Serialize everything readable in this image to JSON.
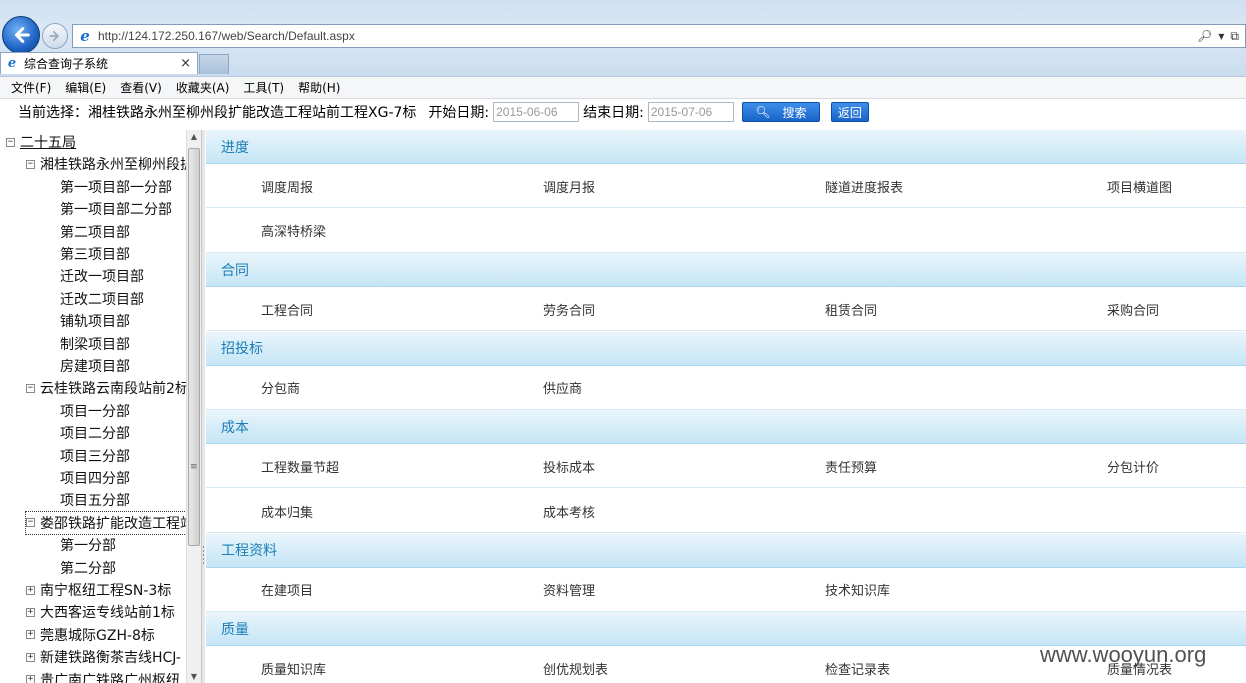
{
  "browser": {
    "url": "http://124.172.250.167/web/Search/Default.aspx",
    "tab_title": "综合查询子系统",
    "tab_close": "×"
  },
  "menu": [
    "文件(F)",
    "编辑(E)",
    "查看(V)",
    "收藏夹(A)",
    "工具(T)",
    "帮助(H)"
  ],
  "filter": {
    "current_label": "当前选择：湘桂铁路永州至柳州段扩能改造工程站前工程XG-7标",
    "start_label": "开始日期:",
    "start_value": "2015-06-06",
    "end_label": "结束日期:",
    "end_value": "2015-07-06",
    "search_label": "搜索",
    "back_label": "返回"
  },
  "tree": [
    {
      "label": "二十五局",
      "toggle": "−"
    },
    {
      "label": "湘桂铁路永州至柳州段扩",
      "toggle": "−"
    },
    {
      "label": "第一项目部一分部"
    },
    {
      "label": "第一项目部二分部"
    },
    {
      "label": "第二项目部"
    },
    {
      "label": "第三项目部"
    },
    {
      "label": "迁改一项目部"
    },
    {
      "label": "迁改二项目部"
    },
    {
      "label": "铺轨项目部"
    },
    {
      "label": "制梁项目部"
    },
    {
      "label": "房建项目部"
    },
    {
      "label": "云桂铁路云南段站前2标",
      "toggle": "−"
    },
    {
      "label": "项目一分部"
    },
    {
      "label": "项目二分部"
    },
    {
      "label": "项目三分部"
    },
    {
      "label": "项目四分部"
    },
    {
      "label": "项目五分部"
    },
    {
      "label": "娄邵铁路扩能改造工程站",
      "toggle": "−"
    },
    {
      "label": "第一分部"
    },
    {
      "label": "第二分部"
    },
    {
      "label": "南宁枢纽工程SN-3标",
      "toggle": "+"
    },
    {
      "label": "大西客运专线站前1标",
      "toggle": "+"
    },
    {
      "label": "莞惠城际GZH-8标",
      "toggle": "+"
    },
    {
      "label": "新建铁路衡茶吉线HCJ-",
      "toggle": "+"
    },
    {
      "label": "贵广南广铁路广州枢纽",
      "toggle": "+"
    }
  ],
  "sections": [
    {
      "title": "进度",
      "rows": [
        [
          "调度周报",
          "调度月报",
          "隧道进度报表",
          "项目横道图"
        ],
        [
          "高深特桥梁"
        ]
      ]
    },
    {
      "title": "合同",
      "rows": [
        [
          "工程合同",
          "劳务合同",
          "租赁合同",
          "采购合同"
        ]
      ]
    },
    {
      "title": "招投标",
      "rows": [
        [
          "分包商",
          "供应商"
        ]
      ]
    },
    {
      "title": "成本",
      "rows": [
        [
          "工程数量节超",
          "投标成本",
          "责任预算",
          "分包计价"
        ],
        [
          "成本归集",
          "成本考核"
        ]
      ]
    },
    {
      "title": "工程资料",
      "rows": [
        [
          "在建项目",
          "资料管理",
          "技术知识库"
        ]
      ]
    },
    {
      "title": "质量",
      "rows": [
        [
          "质量知识库",
          "创优规划表",
          "检查记录表",
          "质量情况表"
        ]
      ]
    }
  ],
  "watermark": "www.wooyun.org",
  "colors": {
    "section_text": "#1a7fb8",
    "section_bg": "#d5ecf8",
    "button": "#1863c9"
  }
}
